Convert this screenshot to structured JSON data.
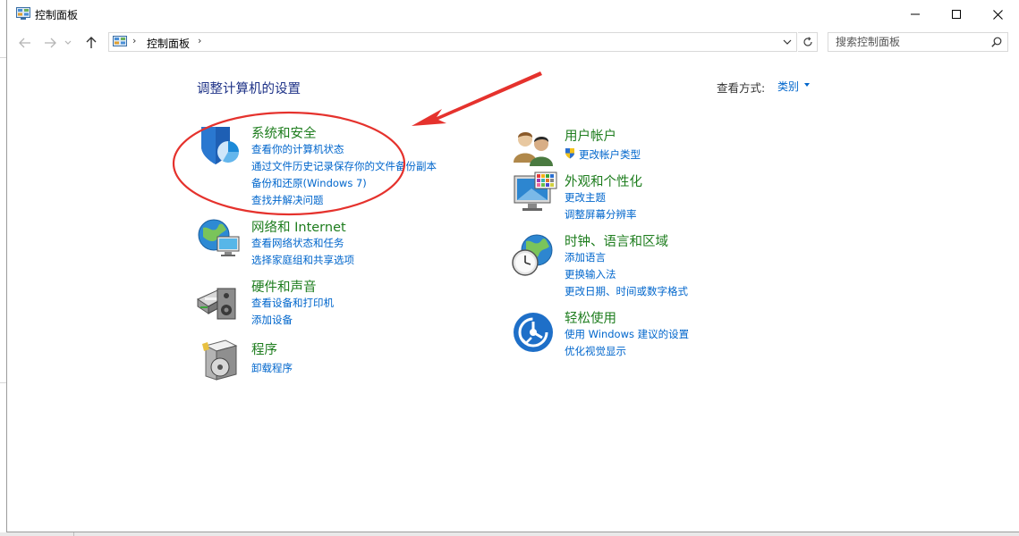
{
  "window": {
    "title": "控制面板",
    "minimize_icon": "minimize-icon",
    "maximize_icon": "maximize-icon",
    "close_icon": "close-icon"
  },
  "address": {
    "path": "控制面板",
    "search_placeholder": "搜索控制面板"
  },
  "content": {
    "title": "调整计算机的设置",
    "view_by_label": "查看方式:",
    "view_by_value": "类别"
  },
  "categories": {
    "system": {
      "title": "系统和安全",
      "icon": "shield-icon",
      "links": [
        "查看你的计算机状态",
        "通过文件历史记录保存你的文件备份副本",
        "备份和还原(Windows 7)",
        "查找并解决问题"
      ]
    },
    "network": {
      "title": "网络和 Internet",
      "icon": "network-globe-icon",
      "links": [
        "查看网络状态和任务",
        "选择家庭组和共享选项"
      ]
    },
    "hardware": {
      "title": "硬件和声音",
      "icon": "printer-speaker-icon",
      "links": [
        "查看设备和打印机",
        "添加设备"
      ]
    },
    "programs": {
      "title": "程序",
      "icon": "programs-disc-icon",
      "links": [
        "卸载程序"
      ]
    },
    "user": {
      "title": "用户帐户",
      "icon": "users-icon",
      "links": [
        "更改帐户类型"
      ]
    },
    "appearance": {
      "title": "外观和个性化",
      "icon": "monitor-palette-icon",
      "links": [
        "更改主题",
        "调整屏幕分辨率"
      ]
    },
    "clock": {
      "title": "时钟、语言和区域",
      "icon": "globe-clock-icon",
      "links": [
        "添加语言",
        "更换输入法",
        "更改日期、时间或数字格式"
      ]
    },
    "ease": {
      "title": "轻松使用",
      "icon": "ease-of-access-icon",
      "links": [
        "使用 Windows 建议的设置",
        "优化视觉显示"
      ]
    }
  },
  "colors": {
    "title_blue": "#1e3287",
    "category_green": "#1e7d1e",
    "link_blue": "#0066cc",
    "annotation_red": "#e5322d"
  }
}
